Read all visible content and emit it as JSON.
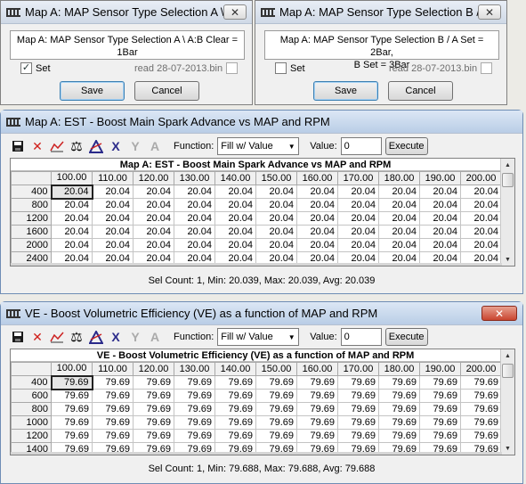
{
  "dialog_a": {
    "title": "Map A: MAP Sensor Type Selection A \\ ...",
    "message_line1": "Map A: MAP Sensor Type Selection A \\ A:B Clear =",
    "message_line2": "1Bar",
    "checkbox_label": "Set",
    "checkbox_checked": "✓",
    "filename": "read 28-07-2013.bin",
    "save": "Save",
    "cancel": "Cancel",
    "close": "✕"
  },
  "dialog_b": {
    "title": "Map A: MAP Sensor Type Selection B / ...",
    "message_line1": "Map A: MAP Sensor Type Selection B / A Set = 2Bar,",
    "message_line2": "B Set = 3Bar",
    "checkbox_label": "Set",
    "filename": "read 28-07-2013.bin",
    "save": "Save",
    "cancel": "Cancel",
    "close": "✕"
  },
  "table_est": {
    "title": "Map A: EST - Boost Main Spark Advance vs MAP and RPM",
    "grid_title": "Map A: EST - Boost Main Spark Advance vs MAP and RPM",
    "function_label": "Function:",
    "function_value": "Fill w/ Value",
    "value_label": "Value:",
    "value": "0",
    "execute": "Execute",
    "columns": [
      "100.00",
      "110.00",
      "120.00",
      "130.00",
      "140.00",
      "150.00",
      "160.00",
      "170.00",
      "180.00",
      "190.00",
      "200.00"
    ],
    "rows": [
      {
        "label": "400",
        "values": [
          "20.04",
          "20.04",
          "20.04",
          "20.04",
          "20.04",
          "20.04",
          "20.04",
          "20.04",
          "20.04",
          "20.04",
          "20.04"
        ]
      },
      {
        "label": "800",
        "values": [
          "20.04",
          "20.04",
          "20.04",
          "20.04",
          "20.04",
          "20.04",
          "20.04",
          "20.04",
          "20.04",
          "20.04",
          "20.04"
        ]
      },
      {
        "label": "1200",
        "values": [
          "20.04",
          "20.04",
          "20.04",
          "20.04",
          "20.04",
          "20.04",
          "20.04",
          "20.04",
          "20.04",
          "20.04",
          "20.04"
        ]
      },
      {
        "label": "1600",
        "values": [
          "20.04",
          "20.04",
          "20.04",
          "20.04",
          "20.04",
          "20.04",
          "20.04",
          "20.04",
          "20.04",
          "20.04",
          "20.04"
        ]
      },
      {
        "label": "2000",
        "values": [
          "20.04",
          "20.04",
          "20.04",
          "20.04",
          "20.04",
          "20.04",
          "20.04",
          "20.04",
          "20.04",
          "20.04",
          "20.04"
        ]
      },
      {
        "label": "2400",
        "values": [
          "20.04",
          "20.04",
          "20.04",
          "20.04",
          "20.04",
          "20.04",
          "20.04",
          "20.04",
          "20.04",
          "20.04",
          "20.04"
        ]
      }
    ],
    "status": "Sel Count: 1, Min: 20.039, Max: 20.039, Avg: 20.039"
  },
  "table_ve": {
    "title": "VE - Boost Volumetric Efficiency (VE) as a function of MAP and RPM",
    "grid_title": "VE - Boost Volumetric Efficiency (VE) as a function of MAP and RPM",
    "function_label": "Function:",
    "function_value": "Fill w/ Value",
    "value_label": "Value:",
    "value": "0",
    "execute": "Execute",
    "close": "✕",
    "columns": [
      "100.00",
      "110.00",
      "120.00",
      "130.00",
      "140.00",
      "150.00",
      "160.00",
      "170.00",
      "180.00",
      "190.00",
      "200.00"
    ],
    "rows": [
      {
        "label": "400",
        "values": [
          "79.69",
          "79.69",
          "79.69",
          "79.69",
          "79.69",
          "79.69",
          "79.69",
          "79.69",
          "79.69",
          "79.69",
          "79.69"
        ]
      },
      {
        "label": "600",
        "values": [
          "79.69",
          "79.69",
          "79.69",
          "79.69",
          "79.69",
          "79.69",
          "79.69",
          "79.69",
          "79.69",
          "79.69",
          "79.69"
        ]
      },
      {
        "label": "800",
        "values": [
          "79.69",
          "79.69",
          "79.69",
          "79.69",
          "79.69",
          "79.69",
          "79.69",
          "79.69",
          "79.69",
          "79.69",
          "79.69"
        ]
      },
      {
        "label": "1000",
        "values": [
          "79.69",
          "79.69",
          "79.69",
          "79.69",
          "79.69",
          "79.69",
          "79.69",
          "79.69",
          "79.69",
          "79.69",
          "79.69"
        ]
      },
      {
        "label": "1200",
        "values": [
          "79.69",
          "79.69",
          "79.69",
          "79.69",
          "79.69",
          "79.69",
          "79.69",
          "79.69",
          "79.69",
          "79.69",
          "79.69"
        ]
      },
      {
        "label": "1400",
        "values": [
          "79.69",
          "79.69",
          "79.69",
          "79.69",
          "79.69",
          "79.69",
          "79.69",
          "79.69",
          "79.69",
          "79.69",
          "79.69"
        ]
      }
    ],
    "status": "Sel Count: 1, Min: 79.688, Max: 79.688, Avg: 79.688"
  },
  "toolbar_icons": [
    "save-icon",
    "delete-icon",
    "graph-icon",
    "balance-icon",
    "interpolate-icon",
    "clear-icon",
    "fork-icon",
    "text-icon"
  ]
}
